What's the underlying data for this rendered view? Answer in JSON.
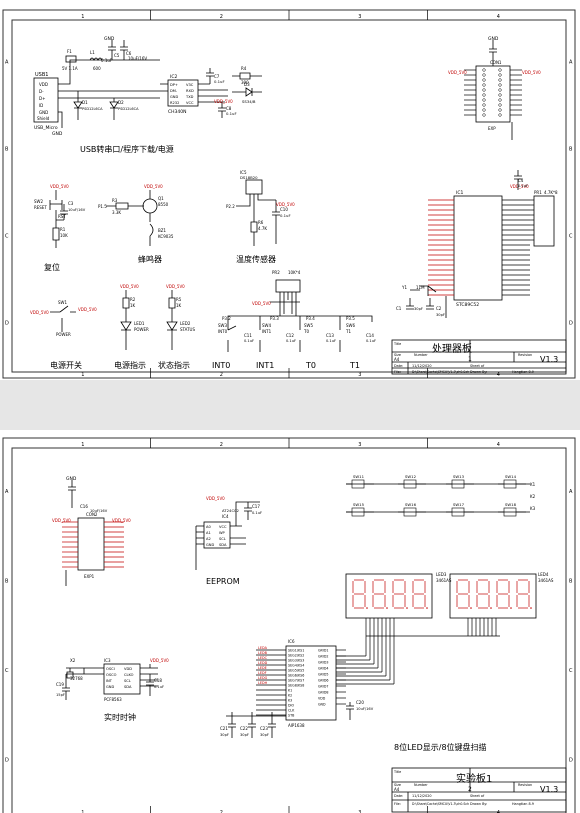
{
  "colors": {
    "wire": "#000000",
    "component": "#0000cc",
    "net": "#c00000",
    "title_text": "#000000",
    "ground_bg": "#e6e6e6"
  },
  "sheet1": {
    "section_titles": {
      "usb": "USB转串口/程序下载/电源",
      "reset": "复位",
      "buzzer": "蜂鸣器",
      "temp": "温度传感器",
      "power_switch": "电源开关",
      "power_led": "电源指示",
      "status_led": "状态指示",
      "int0": "INT0",
      "int1": "INT1",
      "t0": "T0",
      "t1": "T1"
    },
    "parts": {
      "usb": {
        "ref": "USB1",
        "sub": "USB_Micro",
        "pins": [
          "VDD",
          "D-",
          "D+",
          "ID",
          "GND",
          "Shield"
        ]
      },
      "ch340": {
        "ref": "IC2",
        "value": "CH340N",
        "pins_left": [
          "DP+",
          "DM-",
          "GND",
          "R232"
        ],
        "pins_right": [
          "V3C",
          "RXD",
          "TXD",
          "VCC"
        ]
      },
      "f1": {
        "ref": "F1",
        "value": "5V 1.1A"
      },
      "l1": {
        "ref": "L1",
        "value": "600"
      },
      "c5": {
        "ref": "C5",
        "value": "0.1uF"
      },
      "c6": {
        "ref": "C6",
        "value": "10uF/16V"
      },
      "c7": {
        "ref": "C7",
        "value": "0.1uF"
      },
      "c8": {
        "ref": "C8",
        "value": "0.1uF"
      },
      "d1": {
        "ref": "D1",
        "value": "PSD12L6CA"
      },
      "d2": {
        "ref": "D2",
        "value": "PSD12L6CA"
      },
      "d3": {
        "ref": "D3",
        "value": "SS34/B"
      },
      "r4": {
        "ref": "R4",
        "value": "300"
      },
      "reset_sw": {
        "ref": "SW2",
        "value": "RESET"
      },
      "c3": {
        "ref": "C3",
        "value": "10uF/16V"
      },
      "r1": {
        "ref": "R1",
        "value": "10K"
      },
      "rst": {
        "label": "RST"
      },
      "q1": {
        "ref": "Q1",
        "value": "8550"
      },
      "r3": {
        "ref": "R3",
        "value": "3.3K"
      },
      "bz": {
        "ref": "BZ1",
        "value": "KC9035"
      },
      "p15": {
        "label": "P1.5"
      },
      "ic5": {
        "ref": "IC5",
        "value": "DS18B20"
      },
      "r6": {
        "ref": "R6",
        "value": "4.7K"
      },
      "c10": {
        "ref": "C10",
        "value": "0.1uF"
      },
      "p22": {
        "label": "P2.2"
      },
      "sw1": {
        "ref": "SW1",
        "value": "POWER"
      },
      "r2": {
        "ref": "R2",
        "value": "1K"
      },
      "led1": {
        "ref": "LED1",
        "value": "POWER"
      },
      "r5": {
        "ref": "R5",
        "value": "1K"
      },
      "led2": {
        "ref": "LED2",
        "value": "STATUS"
      },
      "rn": {
        "ref": "PR2",
        "value": "10K*4"
      },
      "p32": {
        "label": "P3.2"
      },
      "p33": {
        "label": "P3.3"
      },
      "p34": {
        "label": "P3.4"
      },
      "p35": {
        "label": "P3.5"
      },
      "sw3": {
        "ref": "SW3",
        "value": "INT0"
      },
      "sw4": {
        "ref": "SW4",
        "value": "INT1"
      },
      "sw5": {
        "ref": "SW5",
        "value": "T0"
      },
      "sw6": {
        "ref": "SW6",
        "value": "T1"
      },
      "c11": {
        "ref": "C11",
        "value": "0.1uF"
      },
      "c12": {
        "ref": "C12",
        "value": "0.1uF"
      },
      "c13": {
        "ref": "C13",
        "value": "0.1uF"
      },
      "c14": {
        "ref": "C14",
        "value": "0.1uF"
      },
      "con1": {
        "ref": "CON1",
        "value": "EXP"
      },
      "mcu": {
        "ref": "IC1",
        "value": "STC89C52"
      },
      "y1": {
        "ref": "Y1",
        "value": "11M"
      },
      "c1": {
        "ref": "C1",
        "value": "30pF"
      },
      "c2": {
        "ref": "C2",
        "value": "30pF"
      },
      "c4": {
        "ref": "C4",
        "value": "0.1uF"
      },
      "pr1": {
        "ref": "PR1",
        "value": "4.7K*8"
      }
    },
    "power_net": "VDD_5V0",
    "gnd": "GND",
    "title_block": {
      "title": "处理器板",
      "number": "1",
      "revision": "V1.3",
      "size": "A4",
      "date": "11/12/2020",
      "sheet": "Sheet of",
      "file": "D:\\Share\\Cache\\SMCU\\V1.3\\ch0.Sch",
      "drawn": "Drawn By:",
      "drawn_by": "Hangtian 8.9"
    }
  },
  "sheet2": {
    "section_titles": {
      "eeprom": "EEPROM",
      "rtc": "实时时钟",
      "display": "8位LED显示/8位键盘扫描"
    },
    "parts": {
      "con2": {
        "ref": "CON2",
        "value": "EXP1"
      },
      "c16": {
        "ref": "C16",
        "value": "10uF/16V"
      },
      "ic4": {
        "ref": "IC4",
        "value": "AT24C02",
        "pins": [
          "A0",
          "A1",
          "A2",
          "GND",
          "VCC",
          "WP",
          "SCL",
          "SDA"
        ]
      },
      "c17": {
        "ref": "C17",
        "value": "0.1uF"
      },
      "ic3": {
        "ref": "IC3",
        "value": "PCF8563",
        "pins": [
          "OSCI",
          "OSCO",
          "INT",
          "GND",
          "VDD",
          "CLKO",
          "SCL",
          "SDA"
        ]
      },
      "x2": {
        "ref": "X2",
        "value": "32768"
      },
      "c19": {
        "ref": "C19",
        "value": "15pF"
      },
      "c18": {
        "ref": "C18",
        "value": "0.1uF"
      },
      "ic6": {
        "ref": "IC6",
        "value": "AIP1638",
        "pins_left": [
          "SEG1/KS1",
          "SEG2/KS2",
          "SEG3/KS3",
          "SEG4/KS4",
          "SEG5/KS5",
          "SEG6/KS6",
          "SEG7/KS7",
          "SEG8/KS8",
          "K1",
          "K2",
          "K3",
          "DIO",
          "CLK",
          "STB"
        ],
        "pins_right": [
          "GRID1",
          "GRID2",
          "GRID3",
          "GRID4",
          "GRID5",
          "GRID6",
          "GRID7",
          "GRID8",
          "VDD",
          "GND"
        ]
      },
      "led3": {
        "ref": "LED3",
        "value": "3461AS"
      },
      "led4": {
        "ref": "LED4",
        "value": "3461AS"
      },
      "c20": {
        "ref": "C20",
        "value": "10uF/16V"
      },
      "c21": {
        "ref": "C21",
        "value": "30pF"
      },
      "c22": {
        "ref": "C22",
        "value": "30pF"
      },
      "c23": {
        "ref": "C23",
        "value": "30pF"
      },
      "led_nets": [
        "LEDA",
        "LEDB",
        "LEDC",
        "LEDD",
        "LEDE",
        "LEDF",
        "LEDG",
        "LEDH"
      ],
      "switches": [
        "SW11",
        "SW12",
        "SW13",
        "SW14",
        "SW15",
        "SW16",
        "SW17",
        "SW18"
      ],
      "keys": [
        "K1",
        "K2",
        "K3"
      ]
    },
    "title_block": {
      "title": "实验板1",
      "number": "2",
      "revision": "V1.3",
      "size": "A4",
      "date": "11/12/2020",
      "sheet": "Sheet of",
      "file": "D:\\Share\\Cache\\SMCU\\V1.3\\ch0.Sch",
      "drawn": "Drawn By:",
      "drawn_by": "Hangtian 8.9"
    }
  },
  "frame_labels": {
    "cols": [
      "1",
      "2",
      "3",
      "4"
    ],
    "rows": [
      "A",
      "B",
      "C",
      "D"
    ]
  }
}
